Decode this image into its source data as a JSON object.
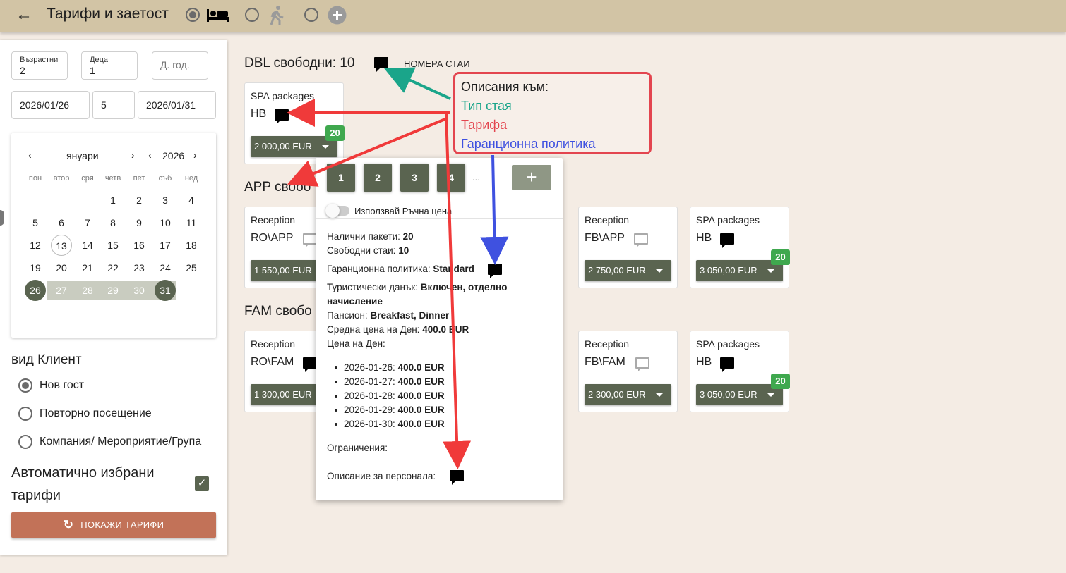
{
  "header": {
    "title": "Тарифи и заетост"
  },
  "filters": {
    "adults_label": "Възрастни",
    "adults": "2",
    "children_label": "Деца",
    "children": "1",
    "child_age_placeholder": "Д. год.",
    "date_from": "2026/01/26",
    "nights": "5",
    "date_to": "2026/01/31"
  },
  "calendar": {
    "month": "януари",
    "year": "2026",
    "prev": "‹",
    "next": "›",
    "weekdays": [
      "пон",
      "втор",
      "сря",
      "четв",
      "пет",
      "съб",
      "нед"
    ],
    "days": [
      "1",
      "2",
      "3",
      "4",
      "5",
      "6",
      "7",
      "8",
      "9",
      "10",
      "11",
      "12",
      "13",
      "14",
      "15",
      "16",
      "17",
      "18",
      "19",
      "20",
      "21",
      "22",
      "23",
      "24",
      "25",
      "26",
      "27",
      "28",
      "29",
      "30",
      "31"
    ]
  },
  "client": {
    "heading": "вид Клиент",
    "options": [
      "Нов гост",
      "Повторно посещение",
      "Компания/ Мероприятие/Група"
    ],
    "auto_label_1": "Автоматично избрани",
    "auto_label_2": "тарифи",
    "show_button": "ПОКАЖИ ТАРИФИ"
  },
  "rooms": {
    "dbl": "DBL свободни: 10",
    "room_numbers": "НОМЕРА СТАИ",
    "app": "APP свобо",
    "fam": "FAM свобо"
  },
  "cards": {
    "dbl_spa": {
      "category": "SPA packages",
      "code": "НВ",
      "price": "2 000,00 EUR",
      "badge": "20"
    },
    "app_rec": {
      "category": "Reception",
      "code": "RO\\APP",
      "price": "1 550,00 EUR"
    },
    "app_fb": {
      "category": "Reception",
      "code": "FB\\APP",
      "price": "2 750,00 EUR"
    },
    "app_spa": {
      "category": "SPA packages",
      "code": "НВ",
      "price": "3 050,00 EUR",
      "badge": "20"
    },
    "fam_rec": {
      "category": "Reception",
      "code": "RO\\FAM",
      "price": "1 300,00 EUR"
    },
    "fam_fb": {
      "category": "Reception",
      "code": "FB\\FAM",
      "price": "2 300,00 EUR"
    },
    "fam_spa": {
      "category": "SPA packages",
      "code": "НВ",
      "price": "3 050,00 EUR",
      "badge": "20"
    }
  },
  "popup": {
    "rooms": [
      "1",
      "2",
      "3",
      "4"
    ],
    "more": "...",
    "plus": "+",
    "manual_price": "Използвай Ръчна цена",
    "packages_label": "Налични пакети: ",
    "packages": "20",
    "free_label": "Свободни стаи: ",
    "free": "10",
    "guarantee_label": "Гаранционна политика: ",
    "guarantee": "Standard",
    "tax_label": "Туристически данък: ",
    "tax_1": "Включен, отделно",
    "tax_2": "начисление",
    "board_label": "Пансион: ",
    "board": "Breakfast, Dinner",
    "avg_label": "Средна цена на Ден: ",
    "avg": "400.0 EUR",
    "per_day_label": "Цена на Ден:",
    "days": [
      {
        "date": "2026-01-26: ",
        "price": "400.0 EUR"
      },
      {
        "date": "2026-01-27: ",
        "price": "400.0 EUR"
      },
      {
        "date": "2026-01-28: ",
        "price": "400.0 EUR"
      },
      {
        "date": "2026-01-29: ",
        "price": "400.0 EUR"
      },
      {
        "date": "2026-01-30: ",
        "price": "400.0 EUR"
      }
    ],
    "restrictions": "Ограничения:",
    "staff_desc": "Описание за персонала:"
  },
  "annotation": {
    "title": "Описания към:",
    "room_type": "Тип стая",
    "rate": "Тарифа",
    "guarantee": "Гаранционна политика",
    "colors": {
      "room_type": "#1aa58a",
      "rate": "#e3454f",
      "guarantee": "#3f51e0"
    }
  },
  "colors": {
    "topbar": "#d2c4a5",
    "accent": "#5a6450",
    "show_button": "#c27258",
    "badge": "#3fa84e"
  }
}
